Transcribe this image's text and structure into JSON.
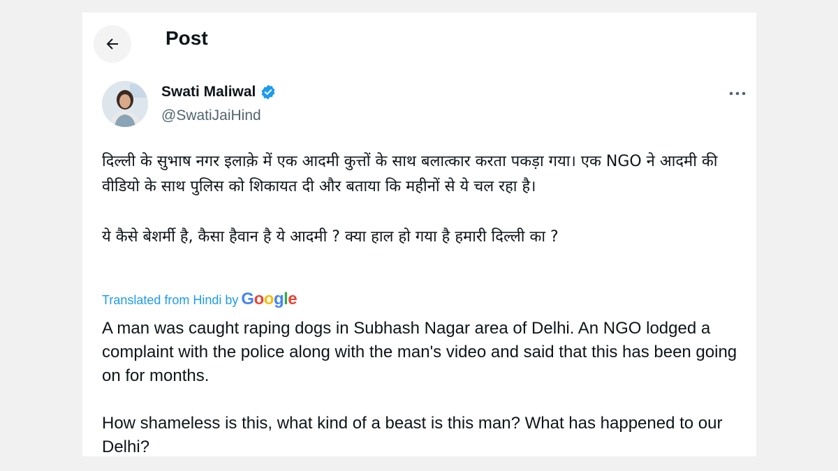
{
  "header": {
    "title": "Post",
    "back_icon": "arrow-left-icon"
  },
  "author": {
    "display_name": "Swati Maliwal",
    "handle": "@SwatiJaiHind",
    "verified_icon": "verified-badge-icon",
    "verified_color": "#1d9bf0"
  },
  "menu": {
    "icon": "more-horizontal-icon"
  },
  "post": {
    "original_paragraphs": [
      "दिल्ली के सुभाष नगर इलाक़े में एक आदमी कुत्तों के साथ बलात्कार करता पकड़ा गया। एक NGO ने आदमी की वीडियो के साथ पुलिस को शिकायत दी और बताया कि महीनों से ये चल रहा है।",
      "ये कैसे बेशर्मी है, कैसा हैवान है ये आदमी ? क्या हाल हो गया है हमारी दिल्ली का ?"
    ],
    "translation_label": "Translated from Hindi by",
    "translation_provider": "Google",
    "translated_paragraphs": [
      "A man was caught raping dogs in Subhash Nagar area of Delhi. An NGO lodged a complaint with the police along with the man's video and said that this has been going on for months.",
      "How shameless is this, what kind of a beast is this man? What has happened to our Delhi?"
    ]
  },
  "colors": {
    "link": "#1d9bf0",
    "secondary_text": "#536471",
    "primary_text": "#0f1419",
    "background": "#f1f1f1"
  }
}
